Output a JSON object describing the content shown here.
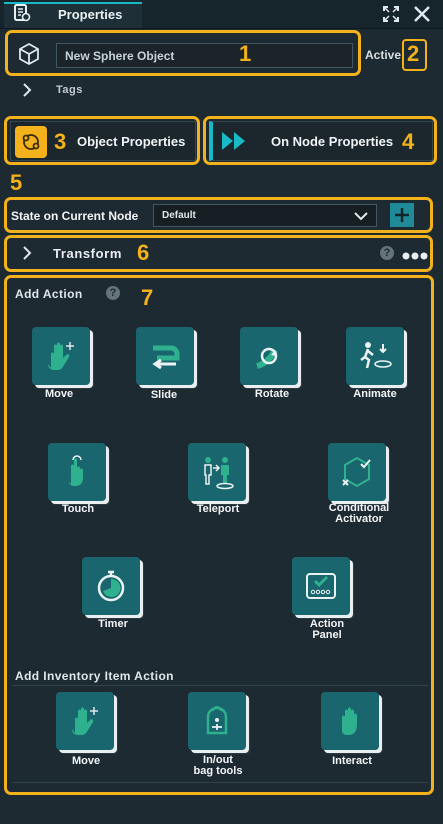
{
  "window": {
    "tab_title": "Properties"
  },
  "object": {
    "name": "New Sphere Object",
    "active_label": "Active",
    "tags_label": "Tags"
  },
  "buttons": {
    "object_properties": "Object Properties",
    "on_node_properties": "On Node Properties"
  },
  "state": {
    "label": "State on Current Node",
    "selected": "Default"
  },
  "transform": {
    "label": "Transform"
  },
  "add_action": {
    "title": "Add Action",
    "items": [
      {
        "label": "Move",
        "icon": "hand-move-icon"
      },
      {
        "label": "Slide",
        "icon": "slide-icon"
      },
      {
        "label": "Rotate",
        "icon": "rotate-icon"
      },
      {
        "label": "Animate",
        "icon": "animate-icon"
      },
      {
        "label": "Touch",
        "icon": "touch-icon"
      },
      {
        "label": "Teleport",
        "icon": "teleport-icon"
      },
      {
        "label": "Conditional\nActivator",
        "icon": "conditional-activator-icon"
      },
      {
        "label": "Timer",
        "icon": "timer-icon"
      },
      {
        "label": "Action\nPanel",
        "icon": "action-panel-icon"
      }
    ]
  },
  "add_inventory": {
    "title": "Add Inventory Item Action",
    "items": [
      {
        "label": "Move",
        "icon": "hand-move-icon"
      },
      {
        "label": "In/out\nbag tools",
        "icon": "backpack-icon"
      },
      {
        "label": "Interact",
        "icon": "hand-interact-icon"
      }
    ]
  },
  "annotations": [
    "1",
    "2",
    "3",
    "4",
    "5",
    "6",
    "7"
  ],
  "colors": {
    "highlight": "#f3b21b",
    "accent": "#1ab9c8",
    "tile": "#19666e",
    "background": "#1e2a31"
  }
}
